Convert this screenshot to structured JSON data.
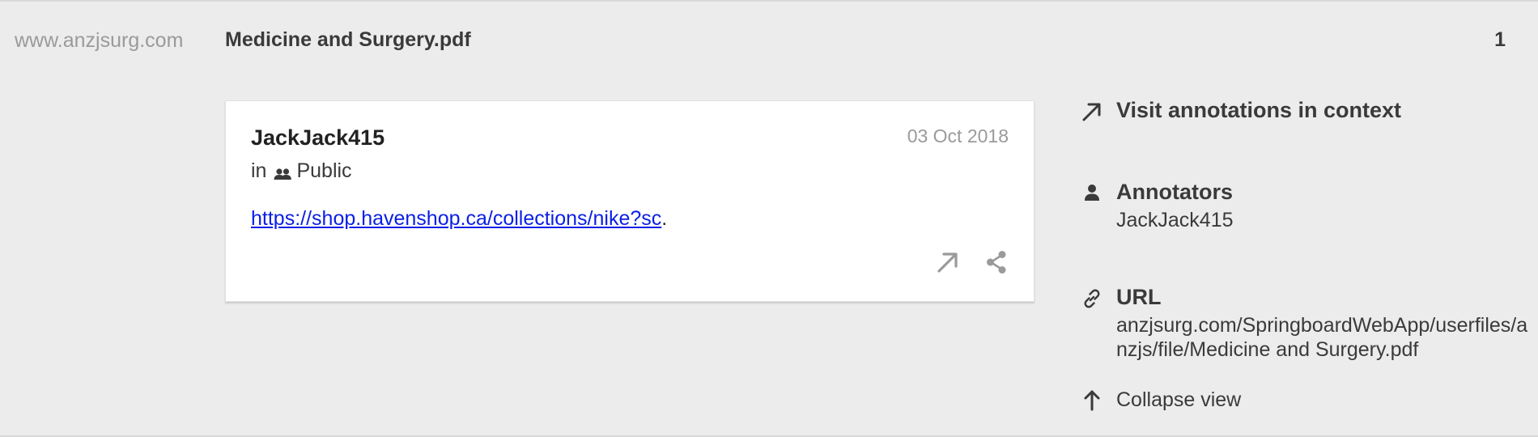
{
  "header": {
    "domain": "www.anzjsurg.com",
    "document_title": "Medicine and Surgery.pdf",
    "annotation_count": "1"
  },
  "annotation": {
    "user": "JackJack415",
    "date": "03 Oct 2018",
    "group_prefix": "in",
    "group_name": "Public",
    "group_icon": "group-icon",
    "link_text": "https://shop.havenshop.ca/collections/nike?sc",
    "trailing_text": ".",
    "link_color": "#0a1ee6",
    "actions": [
      {
        "icon": "external-link-icon"
      },
      {
        "icon": "share-icon"
      }
    ]
  },
  "sidebar": {
    "visit_label": "Visit annotations in context",
    "annotators_title": "Annotators",
    "annotators_value": "JackJack415",
    "url_title": "URL",
    "url_value": "anzjsurg.com/SpringboardWebApp/userfiles/anzjs/file/Medicine and Surgery.pdf",
    "collapse_label": "Collapse view"
  },
  "colors": {
    "background": "#ececec",
    "card": "#ffffff",
    "muted_text": "#9a9a9a",
    "primary_text": "#3a3a3a"
  }
}
